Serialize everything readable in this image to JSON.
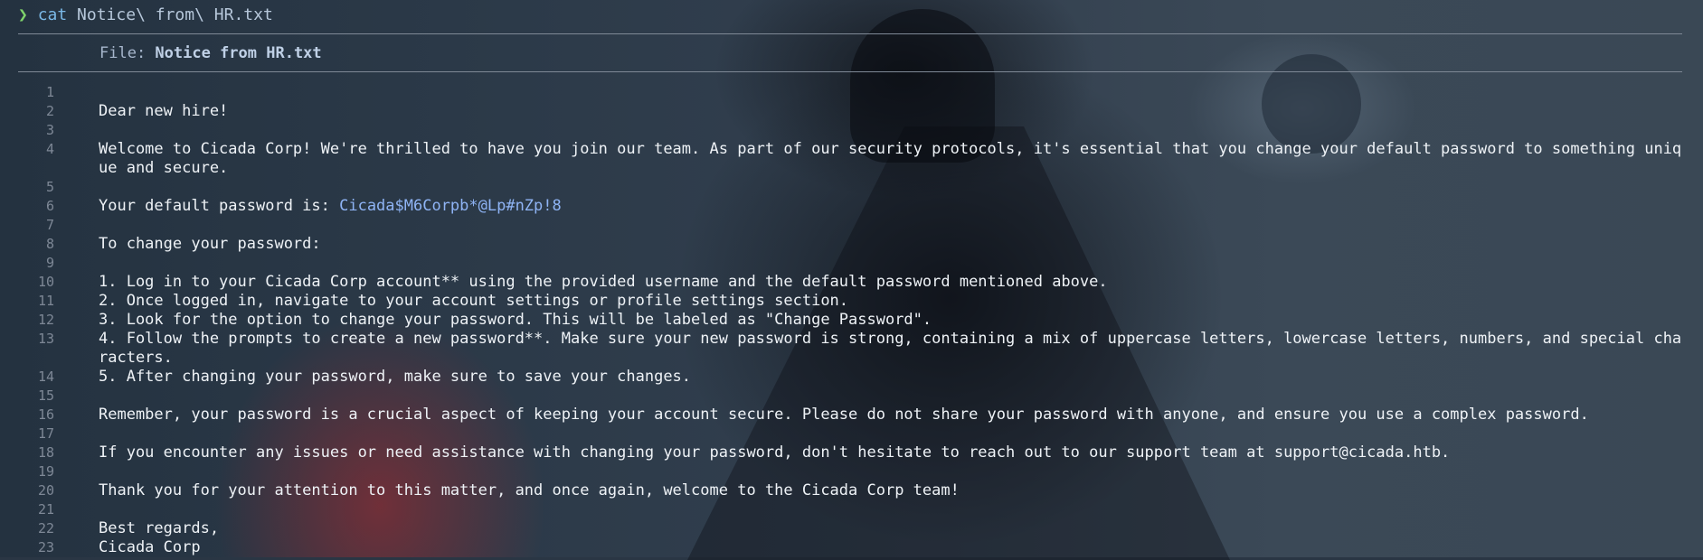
{
  "prompt": {
    "arrow": "❯",
    "command": "cat",
    "argument": "Notice\\ from\\ HR.txt"
  },
  "file_header": {
    "label": "File: ",
    "filename": "Notice from HR.txt"
  },
  "lines": [
    {
      "n": "1",
      "text": ""
    },
    {
      "n": "2",
      "text": "Dear new hire!"
    },
    {
      "n": "3",
      "text": ""
    },
    {
      "n": "4",
      "text": "Welcome to Cicada Corp! We're thrilled to have you join our team. As part of our security protocols, it's essential that you change your default password to something unique and secure."
    },
    {
      "n": "5",
      "text": ""
    },
    {
      "n": "6",
      "text": "Your default password is: ",
      "highlight": "Cicada$M6Corpb*@Lp#nZp!8"
    },
    {
      "n": "7",
      "text": ""
    },
    {
      "n": "8",
      "text": "To change your password:"
    },
    {
      "n": "9",
      "text": ""
    },
    {
      "n": "10",
      "text": "1. Log in to your Cicada Corp account** using the provided username and the default password mentioned above."
    },
    {
      "n": "11",
      "text": "2. Once logged in, navigate to your account settings or profile settings section."
    },
    {
      "n": "12",
      "text": "3. Look for the option to change your password. This will be labeled as \"Change Password\"."
    },
    {
      "n": "13",
      "text": "4. Follow the prompts to create a new password**. Make sure your new password is strong, containing a mix of uppercase letters, lowercase letters, numbers, and special characters."
    },
    {
      "n": "14",
      "text": "5. After changing your password, make sure to save your changes."
    },
    {
      "n": "15",
      "text": ""
    },
    {
      "n": "16",
      "text": "Remember, your password is a crucial aspect of keeping your account secure. Please do not share your password with anyone, and ensure you use a complex password."
    },
    {
      "n": "17",
      "text": ""
    },
    {
      "n": "18",
      "text": "If you encounter any issues or need assistance with changing your password, don't hesitate to reach out to our support team at support@cicada.htb."
    },
    {
      "n": "19",
      "text": ""
    },
    {
      "n": "20",
      "text": "Thank you for your attention to this matter, and once again, welcome to the Cicada Corp team!"
    },
    {
      "n": "21",
      "text": ""
    },
    {
      "n": "22",
      "text": "Best regards,"
    },
    {
      "n": "23",
      "text": "Cicada Corp"
    }
  ]
}
